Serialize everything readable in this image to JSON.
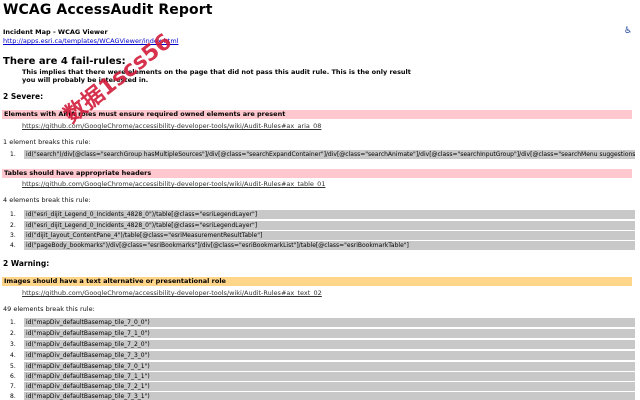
{
  "header": {
    "title": "WCAG AccessAudit Report",
    "subtitle": "Incident Map - WCAG Viewer",
    "url": "http://apps.esri.ca/templates/WCAGViewer/index.html",
    "icon": "accessibility-icon"
  },
  "summary": {
    "heading": "There are 4 fail-rules:",
    "desc1": "This implies that there were elements on the page that did not pass this audit rule. This is the only result",
    "desc2": "you will probably be interested in."
  },
  "severe": {
    "heading": "2 Severe:",
    "rule1": {
      "title": "Elements with ARIA roles must ensure required owned elements are present",
      "link": "https://github.com/GoogleChrome/accessibility-developer-tools/wiki/Audit-Rules#ax_aria_08",
      "count": "1 element breaks this rule:",
      "items": [
        "id(\"search\")/div[@class=\"searchGroup hasMultipleSources\"]/div[@class=\"searchExpandContainer\"]/div[@class=\"searchAnimate\"]/div[@class=\"searchInputGroup\"]/div[@class=\"searchMenu suggestionsMenu\"]"
      ]
    },
    "rule2": {
      "title": "Tables should have appropriate headers",
      "link": "https://github.com/GoogleChrome/accessibility-developer-tools/wiki/Audit-Rules#ax_table_01",
      "count": "4 elements break this rule:",
      "items": [
        "id(\"esri_dijit_Legend_0_Incidents_4828_0\")/table[@class=\"esriLegendLayer\"]",
        "id(\"esri_dijit_Legend_0_Incidents_4828_0\")/table[@class=\"esriLegendLayer\"]",
        "id(\"dijit_layout_ContentPane_4\")/table[@class=\"esriMeasurementResultTable\"]",
        "id(\"pageBody_bookmarks\")/div[@class=\"esriBookmarks\"]/div[@class=\"esriBookmarkList\"]/table[@class=\"esriBookmarkTable\"]"
      ]
    }
  },
  "warning": {
    "heading": "2 Warning:",
    "rule1": {
      "title": "Images should have a text alternative or presentational role",
      "link": "https://github.com/GoogleChrome/accessibility-developer-tools/wiki/Audit-Rules#ax_text_02",
      "count": "49 elements break this rule:",
      "items": [
        "id(\"mapDiv_defaultBasemap_tile_7_0_0\")",
        "id(\"mapDiv_defaultBasemap_tile_7_1_0\")",
        "id(\"mapDiv_defaultBasemap_tile_7_2_0\")",
        "id(\"mapDiv_defaultBasemap_tile_7_3_0\")",
        "id(\"mapDiv_defaultBasemap_tile_7_0_1\")",
        "id(\"mapDiv_defaultBasemap_tile_7_1_1\")",
        "id(\"mapDiv_defaultBasemap_tile_7_2_1\")",
        "id(\"mapDiv_defaultBasemap_tile_7_3_1\")"
      ]
    }
  },
  "list_numbers": [
    "1.",
    "2.",
    "3.",
    "4.",
    "5.",
    "6.",
    "7.",
    "8."
  ],
  "watermark": "数据1scs56",
  "colors": {
    "severe_banner": "#ffc8cf",
    "warning_banner": "#ffd58a",
    "item_bar": "#c8c8c8",
    "link": "#0000cc"
  }
}
